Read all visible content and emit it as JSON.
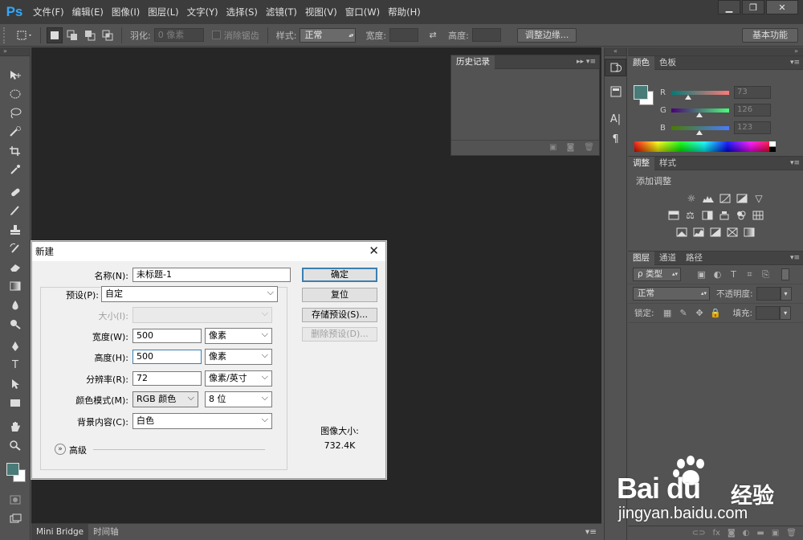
{
  "app": {
    "logo": "Ps"
  },
  "menubar": {
    "items": [
      "文件(F)",
      "编辑(E)",
      "图像(I)",
      "图层(L)",
      "文字(Y)",
      "选择(S)",
      "滤镜(T)",
      "视图(V)",
      "窗口(W)",
      "帮助(H)"
    ],
    "window_controls": {
      "minimize": "▁",
      "maximize": "❐",
      "close": "✕"
    }
  },
  "options_bar": {
    "feather_label": "羽化:",
    "feather_value": "0 像素",
    "antialias_label": "消除锯齿",
    "style_label": "样式:",
    "style_value": "正常",
    "width_label": "宽度:",
    "height_label": "高度:",
    "refine_edge_button": "调整边缘...",
    "workspace_button": "基本功能"
  },
  "bottom_tabs": [
    "Mini Bridge",
    "时间轴"
  ],
  "history_panel": {
    "tab": "历史记录"
  },
  "color_panel": {
    "tabs": [
      "颜色",
      "色板"
    ],
    "foreground_color": "#497b78",
    "background_color": "#ffffff",
    "channels": [
      {
        "label": "R",
        "value": "73",
        "fraction": 0.29,
        "gradient": "linear-gradient(to right,#007b78,#ff7b78)"
      },
      {
        "label": "G",
        "value": "126",
        "fraction": 0.49,
        "gradient": "linear-gradient(to right,#4900 78,#49ff78)"
      },
      {
        "label": "B",
        "value": "123",
        "fraction": 0.48,
        "gradient": "linear-gradient(to right,#497b00,#497bff)"
      }
    ]
  },
  "adjust_panel": {
    "tabs": [
      "调整",
      "样式"
    ],
    "title": "添加调整"
  },
  "layers_panel": {
    "tabs": [
      "图层",
      "通道",
      "路径"
    ],
    "filter_kind": "ρ 类型",
    "blend_mode": "正常",
    "opacity_label": "不透明度:",
    "lock_label": "锁定:",
    "fill_label": "填充:"
  },
  "dialog": {
    "title": "新建",
    "close": "✕",
    "name_label": "名称(N):",
    "name_value": "未标题-1",
    "preset_label": "预设(P):",
    "preset_value": "自定",
    "size_label": "大小(I):",
    "width_label": "宽度(W):",
    "width_value": "500",
    "width_unit": "像素",
    "height_label": "高度(H):",
    "height_value": "500",
    "height_unit": "像素",
    "resolution_label": "分辨率(R):",
    "resolution_value": "72",
    "resolution_unit": "像素/英寸",
    "color_mode_label": "颜色模式(M):",
    "color_mode_value": "RGB 颜色",
    "bit_depth_value": "8 位",
    "background_label": "背景内容(C):",
    "background_value": "白色",
    "advanced_label": "高级",
    "ok_button": "确定",
    "reset_button": "复位",
    "save_preset_button": "存储预设(S)...",
    "delete_preset_button": "删除预设(D)...",
    "image_size_label": "图像大小:",
    "image_size_value": "732.4K"
  },
  "watermark": {
    "brand": "Bai  du",
    "jingyan": "经验",
    "url": "jingyan.baidu.com"
  }
}
